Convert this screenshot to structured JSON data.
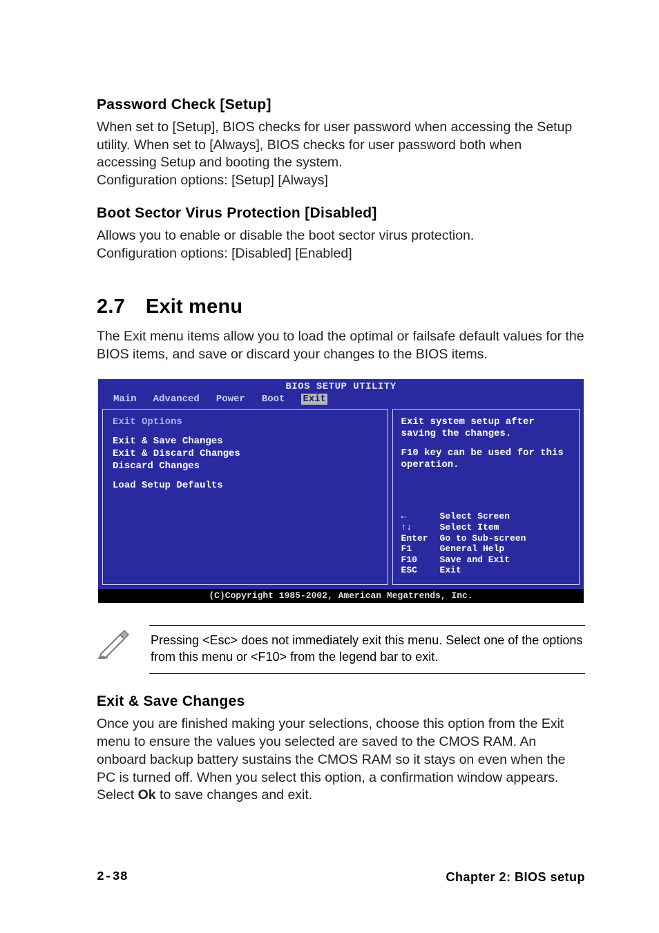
{
  "section1": {
    "title": "Password Check [Setup]",
    "body": "When set to [Setup], BIOS checks for user password when accessing the Setup utility. When set to [Always], BIOS checks for user password both when accessing Setup and booting the system.\nConfiguration options: [Setup] [Always]"
  },
  "section2": {
    "title": "Boot Sector Virus Protection [Disabled]",
    "body": "Allows you to enable or disable the boot sector virus protection.\nConfiguration options: [Disabled] [Enabled]"
  },
  "exitmenu": {
    "number": "2.7",
    "title": "Exit menu",
    "intro": "The Exit menu items allow you to load the optimal or failsafe default values for the BIOS items, and save or discard your changes to the BIOS items."
  },
  "bios": {
    "title": "BIOS SETUP UTILITY",
    "tabs": [
      "Main",
      "Advanced",
      "Power",
      "Boot",
      "Exit"
    ],
    "selected_tab": "Exit",
    "group": "Exit Options",
    "options": [
      "Exit & Save Changes",
      "Exit & Discard Changes",
      "Discard Changes",
      "Load Setup Defaults"
    ],
    "help1": "Exit system setup after saving the changes.",
    "help2": "F10 key can be used for this operation.",
    "keys": [
      {
        "key": "←",
        "label": "Select Screen"
      },
      {
        "key": "↑↓",
        "label": "Select Item"
      },
      {
        "key": "Enter",
        "label": "Go to Sub-screen"
      },
      {
        "key": "F1",
        "label": "General Help"
      },
      {
        "key": "F10",
        "label": "Save and Exit"
      },
      {
        "key": "ESC",
        "label": "Exit"
      }
    ],
    "copyright": "(C)Copyright 1985-2002, American Megatrends, Inc."
  },
  "note": {
    "text_before": "Pressing <Esc> does not immediately exit this menu. Select one of the options from this menu or <F10> from the legend bar to exit."
  },
  "section3": {
    "title": "Exit & Save Changes",
    "body_before": "Once you are finished making your selections, choose this option from the Exit menu to ensure the values you selected are saved to the CMOS RAM. An onboard backup battery sustains the CMOS RAM so it stays on even when the PC is turned off. When you select this option, a confirmation window appears. Select ",
    "bold": "Ok",
    "body_after": " to save changes and exit."
  },
  "footer": {
    "page": "2-38",
    "chapter": "Chapter 2: BIOS setup"
  }
}
